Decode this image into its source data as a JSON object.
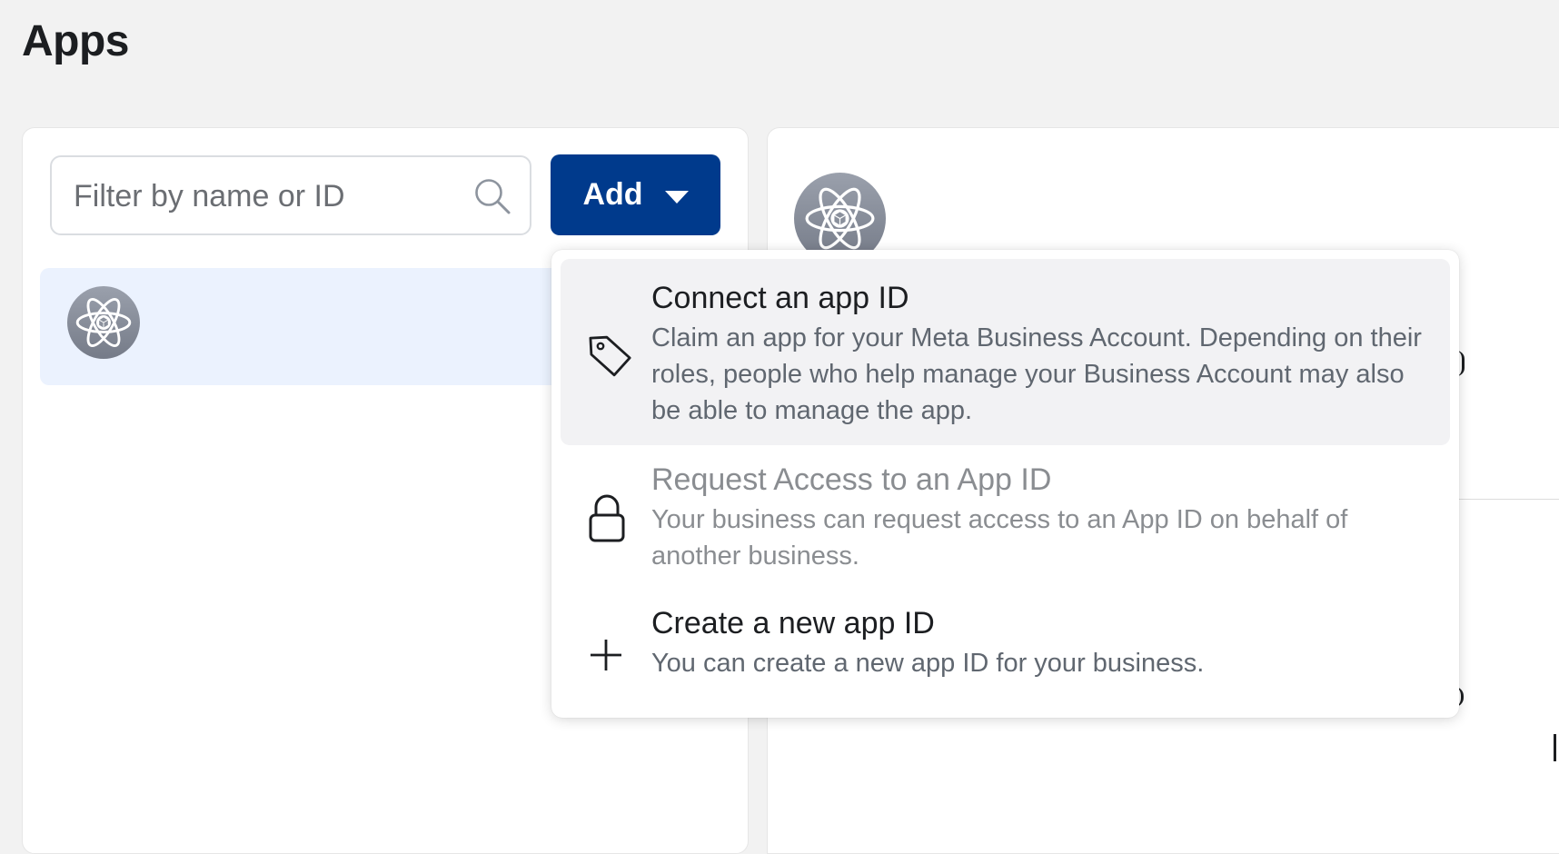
{
  "page": {
    "title": "Apps"
  },
  "search": {
    "placeholder": "Filter by name or ID",
    "value": ""
  },
  "add_button": {
    "label": "Add"
  },
  "dropdown": {
    "items": [
      {
        "title": "Connect an app ID",
        "description": "Claim an app for your Meta Business Account. Depending on their roles, people who help manage your Business Account may also be able to manage the app.",
        "icon": "tag-icon",
        "highlighted": true,
        "disabled": false
      },
      {
        "title": "Request Access to an App ID",
        "description": "Your business can request access to an App ID on behalf of another business.",
        "icon": "lock-icon",
        "highlighted": false,
        "disabled": true
      },
      {
        "title": "Create a new app ID",
        "description": "You can create a new app ID for your business.",
        "icon": "plus-icon",
        "highlighted": false,
        "disabled": false
      }
    ]
  },
  "colors": {
    "add_button_bg": "#003a8c",
    "selected_row_bg": "#ebf2fe",
    "page_bg": "#f2f2f2"
  }
}
